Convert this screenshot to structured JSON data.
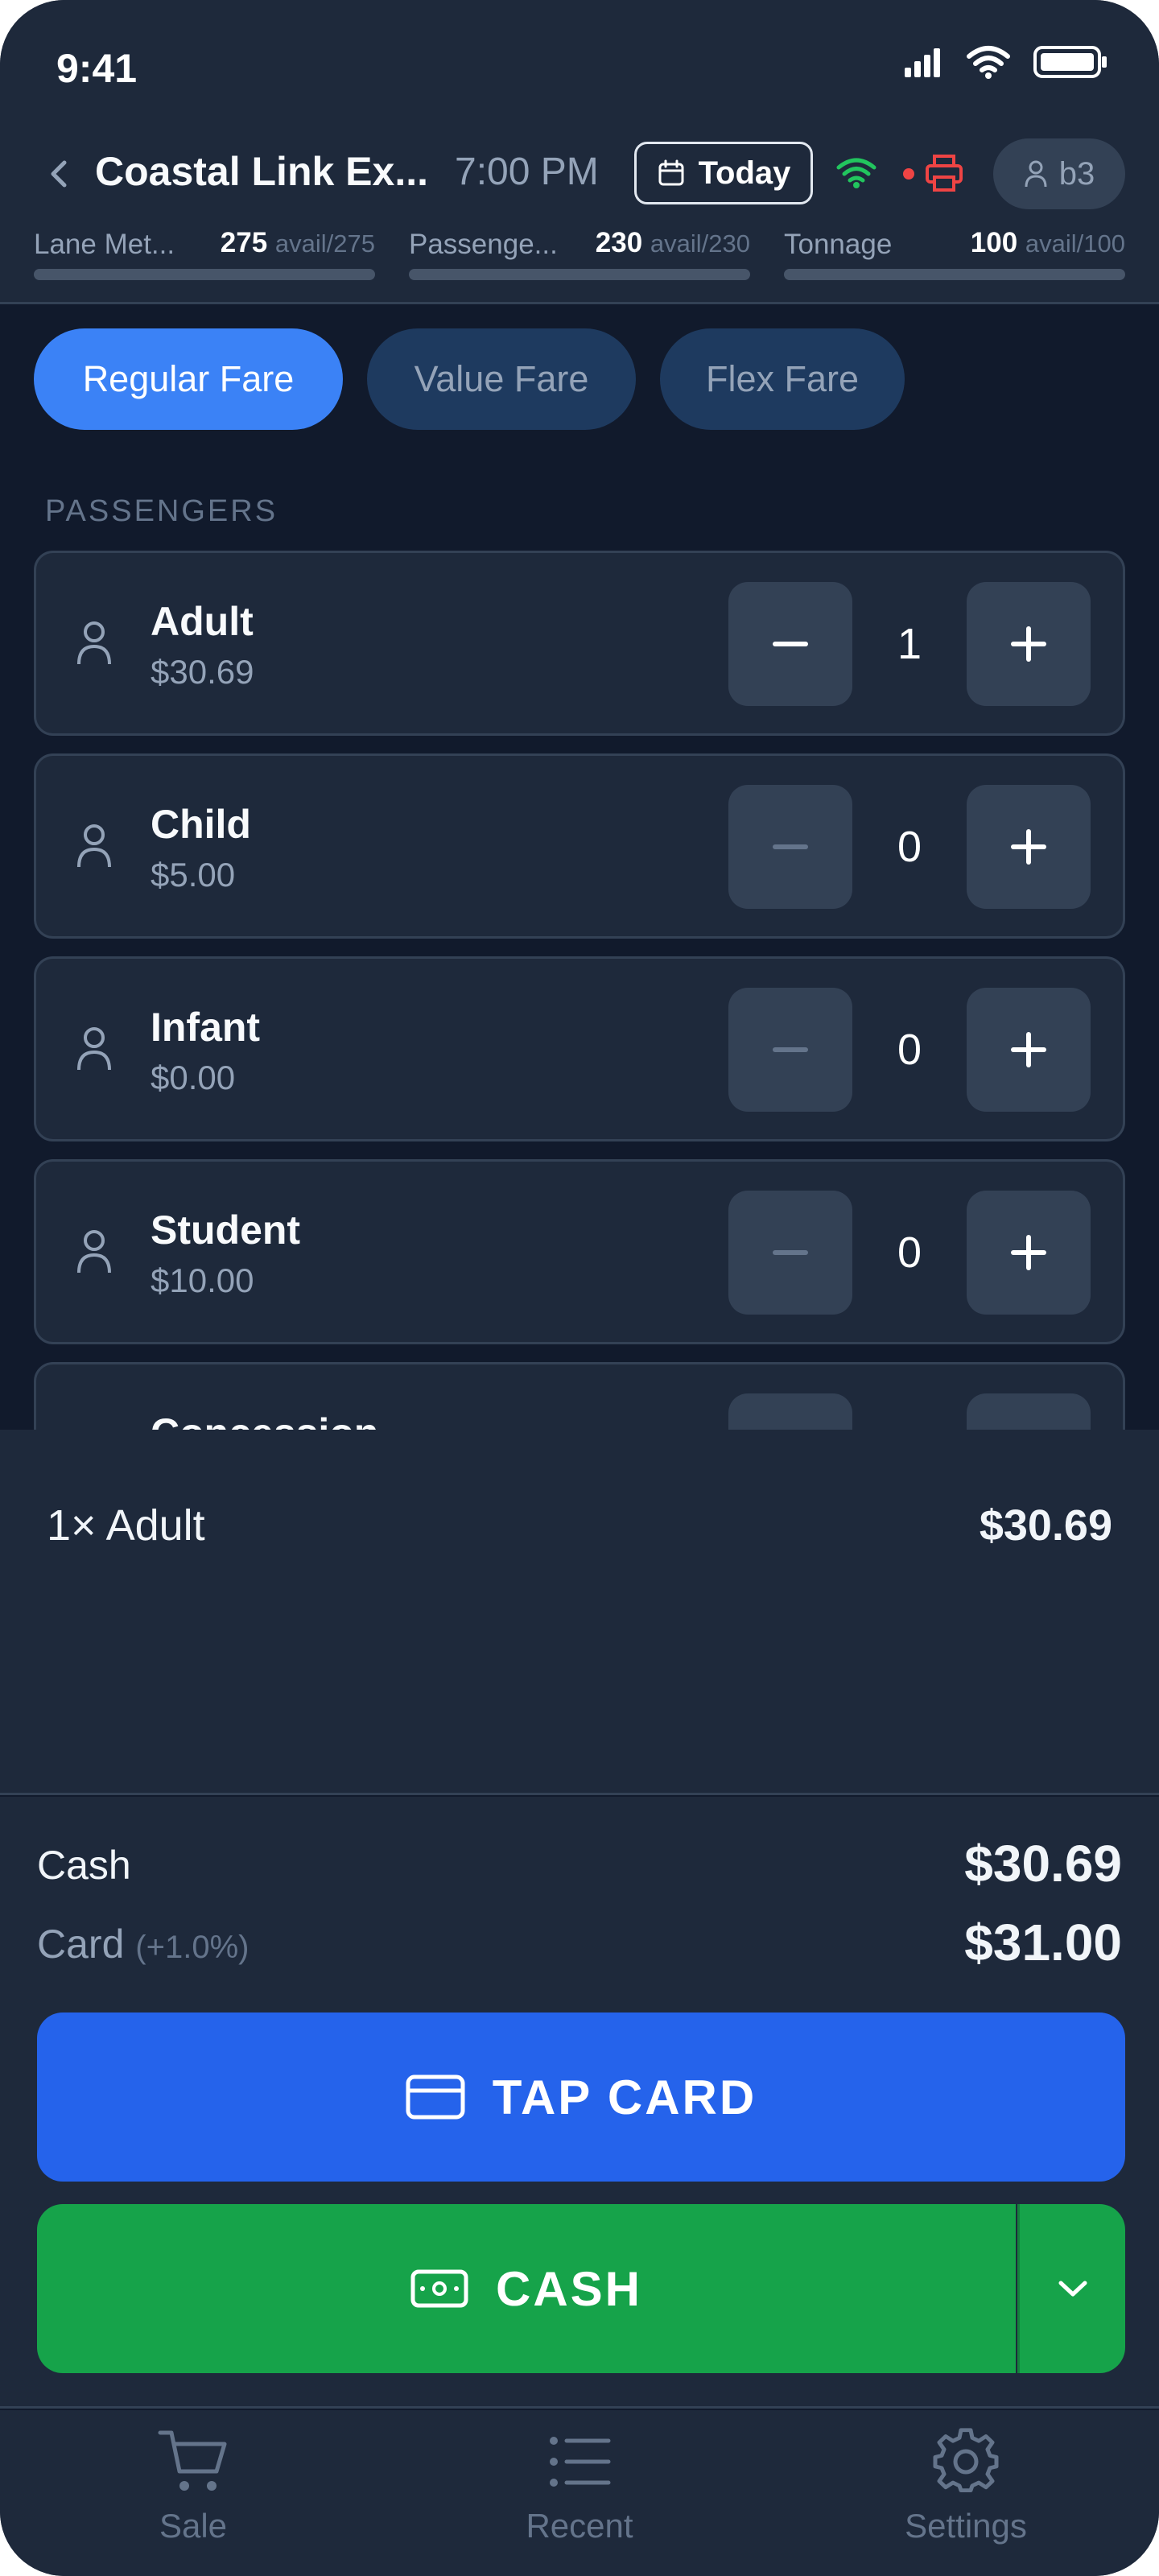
{
  "status_bar": {
    "time": "9:41"
  },
  "header": {
    "title": "Coastal Link Ex...",
    "departure_time": "7:00 PM",
    "date_button_label": "Today",
    "user_label": "b3"
  },
  "capacity": [
    {
      "label": "Lane Met...",
      "value": "275",
      "avail": "avail/275"
    },
    {
      "label": "Passenge...",
      "value": "230",
      "avail": "avail/230"
    },
    {
      "label": "Tonnage",
      "value": "100",
      "avail": "avail/100"
    }
  ],
  "fare_tabs": [
    {
      "label": "Regular Fare",
      "active": true
    },
    {
      "label": "Value Fare",
      "active": false
    },
    {
      "label": "Flex Fare",
      "active": false
    }
  ],
  "passengers_section_label": "PASSENGERS",
  "passengers": [
    {
      "name": "Adult",
      "price": "$30.69",
      "count": "1"
    },
    {
      "name": "Child",
      "price": "$5.00",
      "count": "0"
    },
    {
      "name": "Infant",
      "price": "$0.00",
      "count": "0"
    },
    {
      "name": "Student",
      "price": "$10.00",
      "count": "0"
    },
    {
      "name": "Concession",
      "price": "",
      "count": ""
    }
  ],
  "order_lines": [
    {
      "name": "1× Adult",
      "amount": "$30.69"
    }
  ],
  "totals": {
    "cash_label": "Cash",
    "cash_value": "$30.69",
    "card_label": "Card",
    "card_fee": "(+1.0%)",
    "card_value": "$31.00"
  },
  "actions": {
    "tap_card_label": "TAP CARD",
    "cash_label": "CASH"
  },
  "bottom_nav": [
    {
      "label": "Sale"
    },
    {
      "label": "Recent"
    },
    {
      "label": "Settings"
    }
  ],
  "colors": {
    "primary_blue": "#3b82f6",
    "tap_card_blue": "#2563eb",
    "cash_green": "#16a34a",
    "wifi_green": "#22c55e",
    "printer_red": "#ef4444"
  }
}
